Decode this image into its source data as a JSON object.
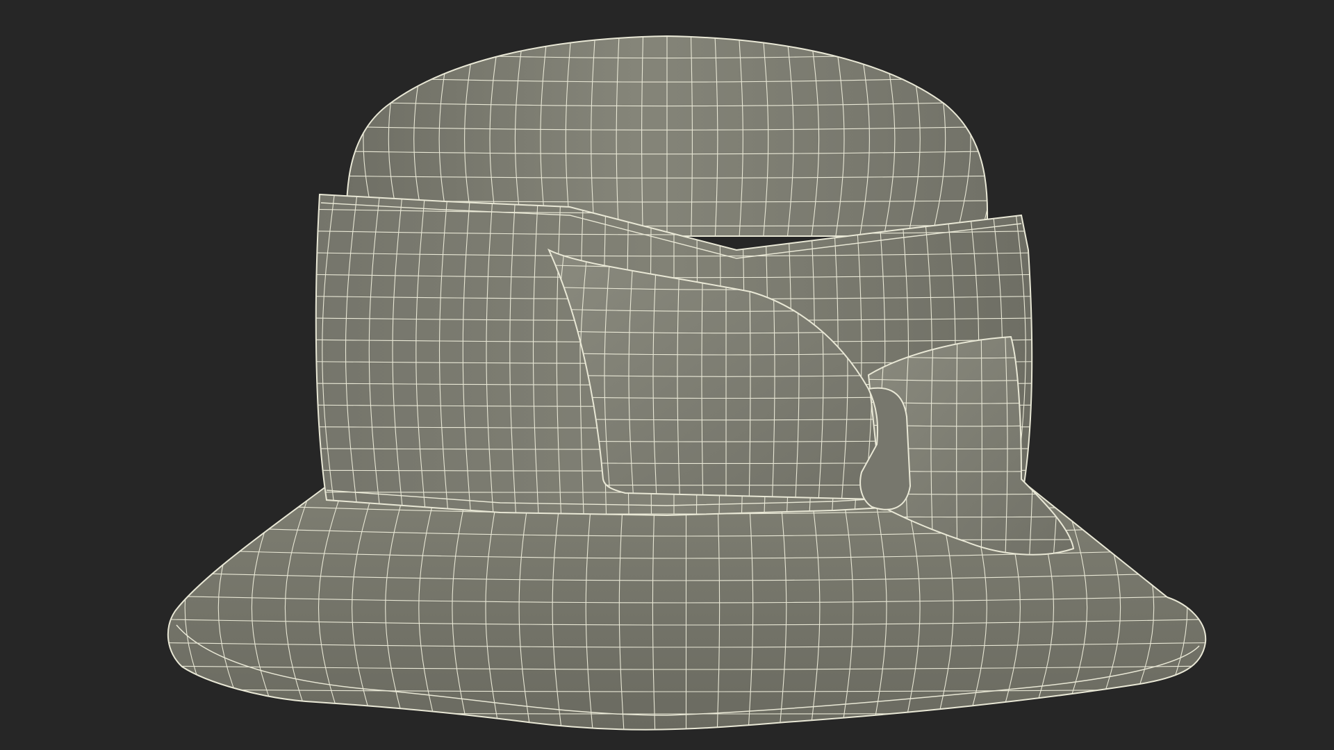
{
  "scene": {
    "subject": "bucket-hat-with-bow",
    "render_mode": "wireframe-over-shaded",
    "colors": {
      "background": "#262626",
      "surface": "#7c7c70",
      "surface_light": "#8d8d81",
      "surface_dark": "#66665c",
      "wire": "#e9e8d6"
    }
  }
}
